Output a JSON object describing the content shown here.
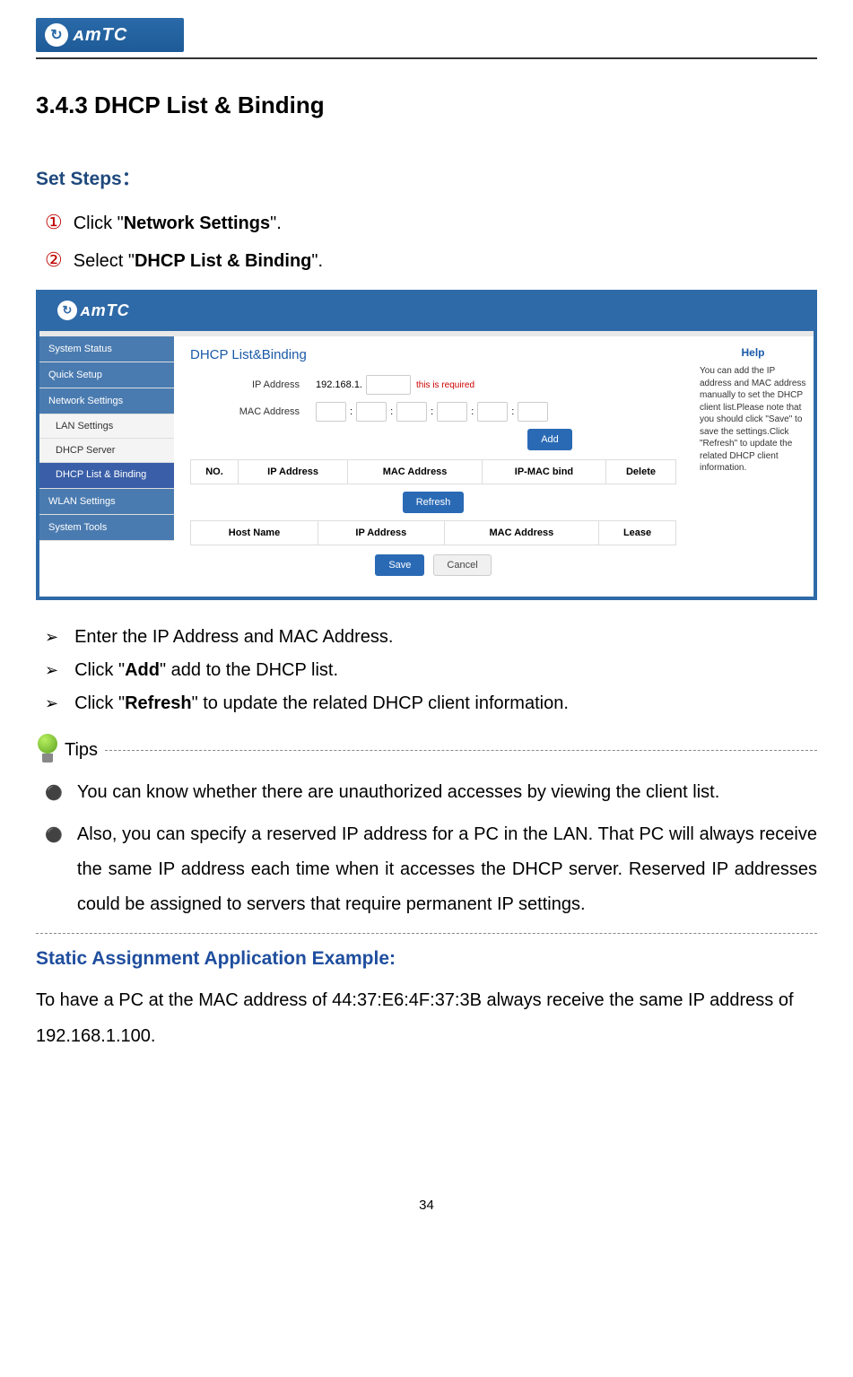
{
  "doc_logo_text": "mTC",
  "section_title": "3.4.3 DHCP List & Binding",
  "set_steps_label": "Set Steps：",
  "steps": [
    {
      "num": "①",
      "prefix": "Click \"",
      "bold": "Network Settings",
      "suffix": "\"."
    },
    {
      "num": "②",
      "prefix": "Select \"",
      "bold": "DHCP List & Binding",
      "suffix": "\"."
    }
  ],
  "screenshot": {
    "logo_text": "mTC",
    "sidebar": {
      "items": [
        {
          "label": "System Status",
          "type": "top"
        },
        {
          "label": "Quick Setup",
          "type": "top"
        },
        {
          "label": "Network Settings",
          "type": "top"
        },
        {
          "label": "LAN Settings",
          "type": "sub"
        },
        {
          "label": "DHCP Server",
          "type": "sub"
        },
        {
          "label": "DHCP List & Binding",
          "type": "active"
        },
        {
          "label": "WLAN Settings",
          "type": "top"
        },
        {
          "label": "System Tools",
          "type": "top"
        }
      ]
    },
    "main": {
      "title": "DHCP List&Binding",
      "ip_label": "IP Address",
      "ip_prefix": "192.168.1.",
      "required": "this is required",
      "mac_label": "MAC Address",
      "add_btn": "Add",
      "table1_headers": [
        "NO.",
        "IP Address",
        "MAC Address",
        "IP-MAC bind",
        "Delete"
      ],
      "refresh_btn": "Refresh",
      "table2_headers": [
        "Host Name",
        "IP Address",
        "MAC Address",
        "Lease"
      ],
      "save_btn": "Save",
      "cancel_btn": "Cancel"
    },
    "help": {
      "title": "Help",
      "text": "You can add the IP address and MAC address manually to set the DHCP client list.Please note that you should click \"Save\" to save the settings.Click \"Refresh\" to update the related DHCP client information."
    }
  },
  "bullets": [
    {
      "text": "Enter the IP Address and MAC Address."
    },
    {
      "prefix": "Click \"",
      "bold": "Add",
      "suffix": "\" add to the DHCP list."
    },
    {
      "prefix": "Click \"",
      "bold": "Refresh",
      "suffix": "\" to update the related DHCP client information."
    }
  ],
  "tips_label": "Tips",
  "tips": [
    "You can know whether there are unauthorized accesses by viewing the client list.",
    "Also, you can specify a reserved IP address for a PC in the LAN. That PC will always receive the same IP address each time when it accesses the DHCP server. Reserved IP addresses could be assigned to servers that require permanent IP settings."
  ],
  "example_title": "Static Assignment Application Example:",
  "example_text": "To have a PC at the MAC address of 44:37:E6:4F:37:3B always receive the same IP address of 192.168.1.100.",
  "page_num": "34"
}
